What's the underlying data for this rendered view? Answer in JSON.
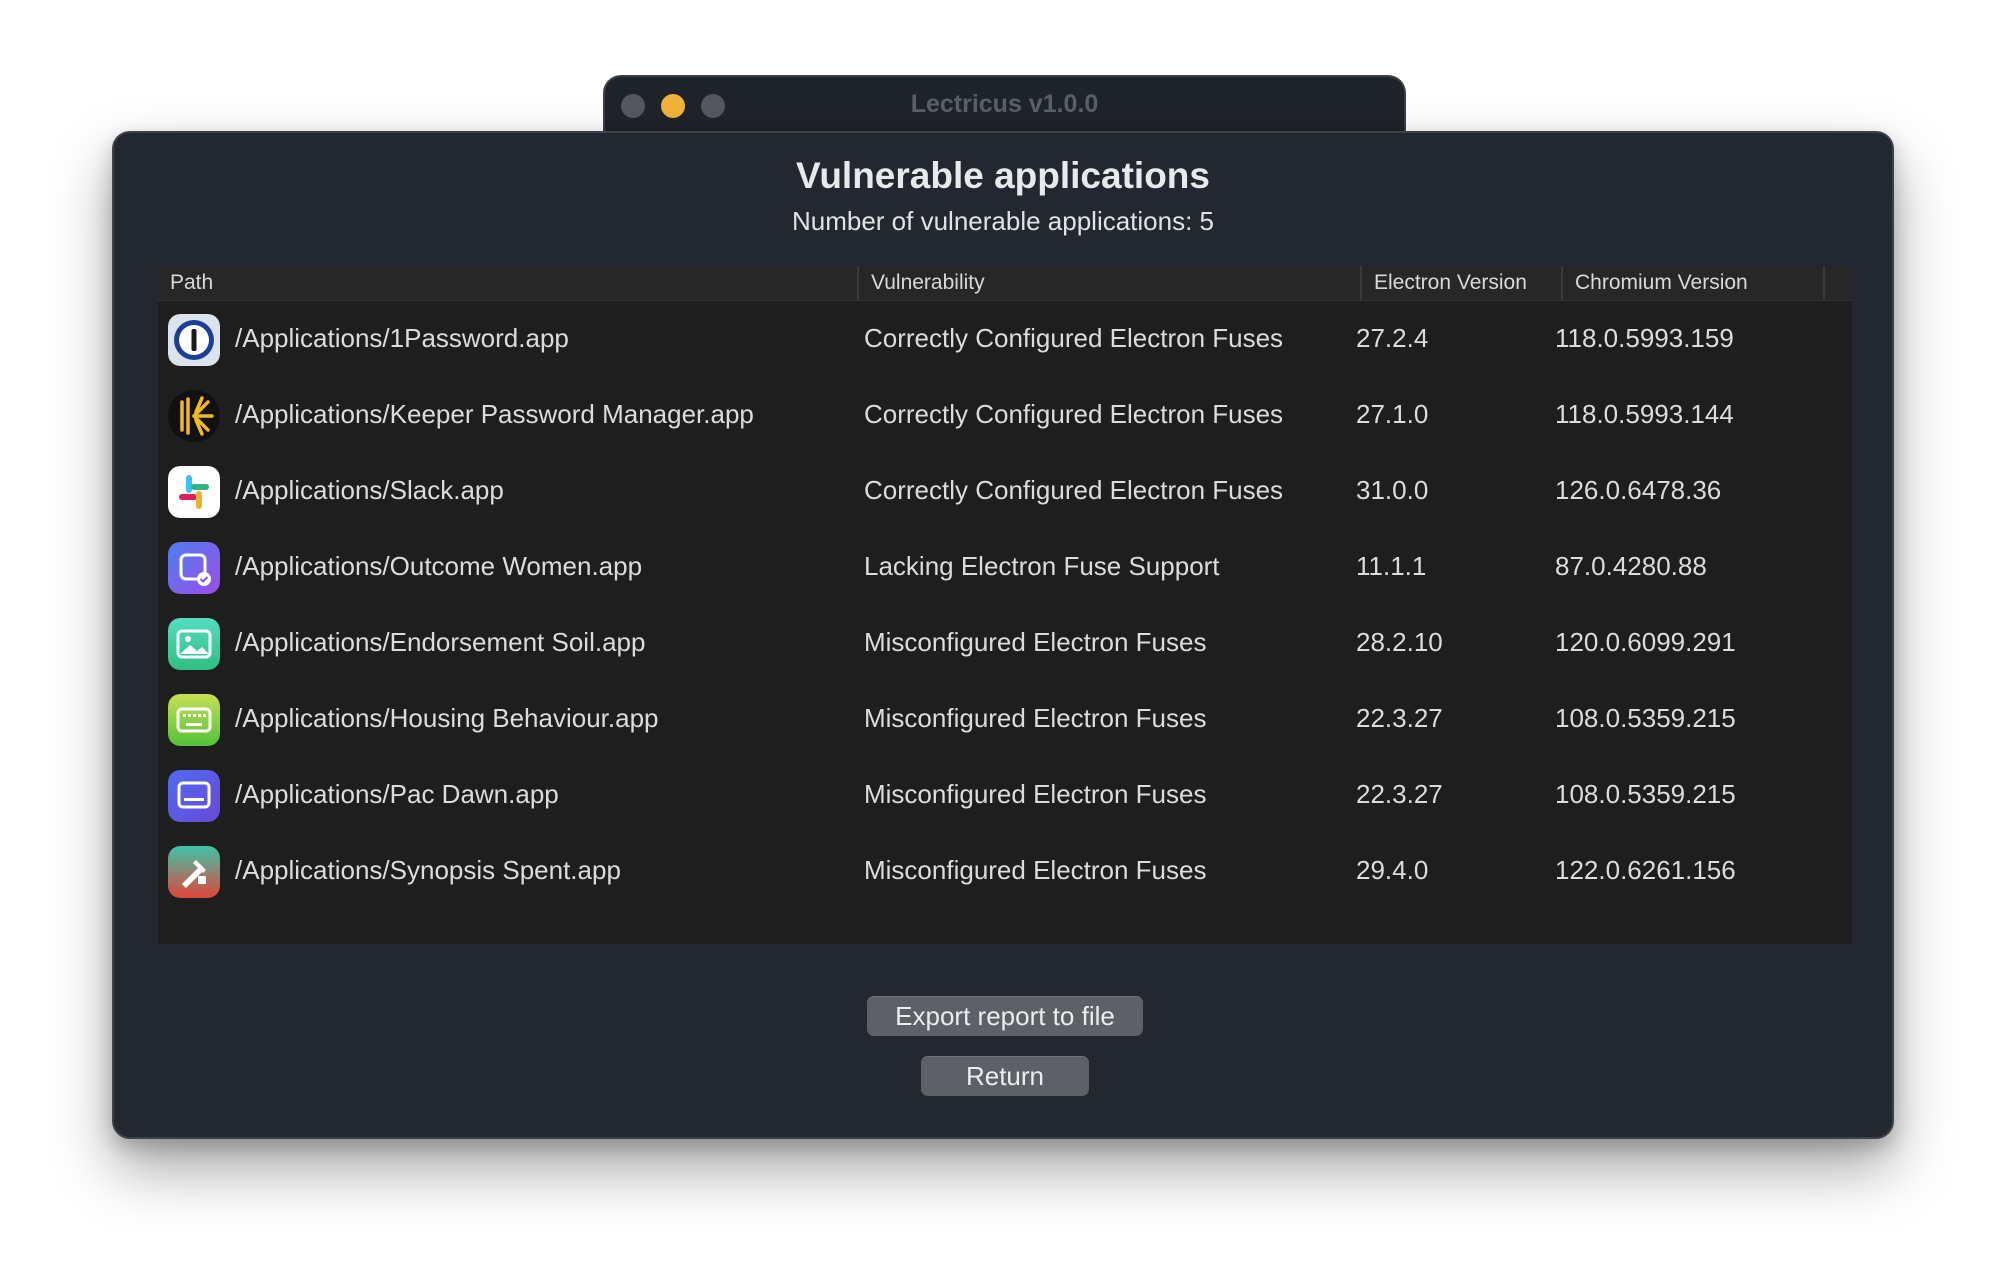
{
  "window": {
    "title": "Lectricus v1.0.0"
  },
  "main": {
    "title": "Vulnerable applications",
    "subtitle": "Number of vulnerable applications: 5"
  },
  "table": {
    "columns": [
      "Path",
      "Vulnerability",
      "Electron Version",
      "Chromium Version"
    ],
    "rows": [
      {
        "icon": "onepassword-app-icon",
        "path": "/Applications/1Password.app",
        "vulnerability": "Correctly Configured Electron Fuses",
        "electron": "27.2.4",
        "chromium": "118.0.5993.159"
      },
      {
        "icon": "keeper-app-icon",
        "path": "/Applications/Keeper Password Manager.app",
        "vulnerability": "Correctly Configured Electron Fuses",
        "electron": "27.1.0",
        "chromium": "118.0.5993.144"
      },
      {
        "icon": "slack-app-icon",
        "path": "/Applications/Slack.app",
        "vulnerability": "Correctly Configured Electron Fuses",
        "electron": "31.0.0",
        "chromium": "126.0.6478.36"
      },
      {
        "icon": "outcome-women-app-icon",
        "path": "/Applications/Outcome Women.app",
        "vulnerability": "Lacking Electron Fuse Support",
        "electron": "11.1.1",
        "chromium": "87.0.4280.88"
      },
      {
        "icon": "endorsement-soil-app-icon",
        "path": "/Applications/Endorsement Soil.app",
        "vulnerability": "Misconfigured Electron Fuses",
        "electron": "28.2.10",
        "chromium": "120.0.6099.291"
      },
      {
        "icon": "housing-behaviour-app-icon",
        "path": "/Applications/Housing Behaviour.app",
        "vulnerability": "Misconfigured Electron Fuses",
        "electron": "22.3.27",
        "chromium": "108.0.5359.215"
      },
      {
        "icon": "pac-dawn-app-icon",
        "path": "/Applications/Pac Dawn.app",
        "vulnerability": "Misconfigured Electron Fuses",
        "electron": "22.3.27",
        "chromium": "108.0.5359.215"
      },
      {
        "icon": "synopsis-spent-app-icon",
        "path": "/Applications/Synopsis Spent.app",
        "vulnerability": "Misconfigured Electron Fuses",
        "electron": "29.4.0",
        "chromium": "122.0.6261.156"
      }
    ]
  },
  "buttons": {
    "export_label": "Export report to file",
    "return_label": "Return"
  },
  "colors": {
    "panel": "#232730",
    "table": "#1e1e1e",
    "button": "#5d6066",
    "minimize": "#f2b33a"
  }
}
